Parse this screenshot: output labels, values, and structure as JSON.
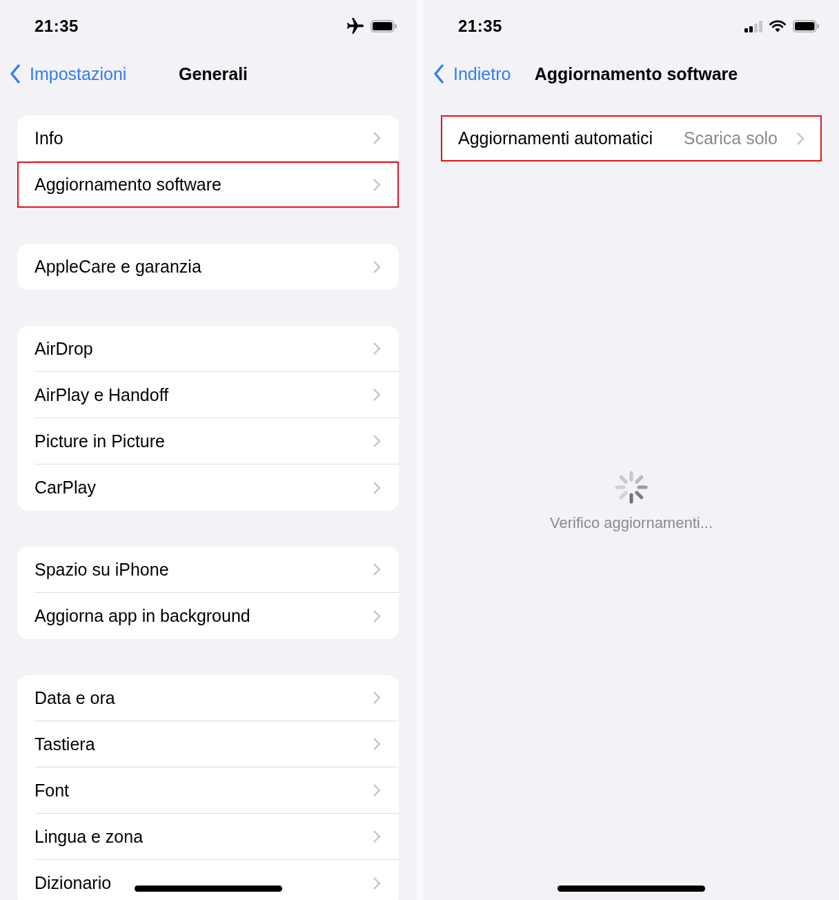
{
  "screens": [
    {
      "status_bar": {
        "time": "21:35",
        "airplane_mode": true
      },
      "nav": {
        "back": "Impostazioni",
        "title": "Generali"
      },
      "groups": [
        {
          "rows": [
            {
              "label": "Info",
              "highlighted": false
            },
            {
              "label": "Aggiornamento software",
              "highlighted": true
            }
          ]
        },
        {
          "rows": [
            {
              "label": "AppleCare e garanzia",
              "highlighted": false
            }
          ]
        },
        {
          "rows": [
            {
              "label": "AirDrop",
              "highlighted": false
            },
            {
              "label": "AirPlay e Handoff",
              "highlighted": false
            },
            {
              "label": "Picture in Picture",
              "highlighted": false
            },
            {
              "label": "CarPlay",
              "highlighted": false
            }
          ]
        },
        {
          "rows": [
            {
              "label": "Spazio su iPhone",
              "highlighted": false
            },
            {
              "label": "Aggiorna app in background",
              "highlighted": false
            }
          ]
        },
        {
          "rows": [
            {
              "label": "Data e ora",
              "highlighted": false
            },
            {
              "label": "Tastiera",
              "highlighted": false
            },
            {
              "label": "Font",
              "highlighted": false
            },
            {
              "label": "Lingua e zona",
              "highlighted": false
            },
            {
              "label": "Dizionario",
              "highlighted": false
            }
          ]
        }
      ]
    },
    {
      "status_bar": {
        "time": "21:35",
        "airplane_mode": false
      },
      "nav": {
        "back": "Indietro",
        "title": "Aggiornamento software"
      },
      "groups": [
        {
          "rows": [
            {
              "label": "Aggiornamenti automatici",
              "value": "Scarica solo",
              "highlighted": true
            }
          ]
        }
      ],
      "status": {
        "loading": true,
        "message": "Verifico aggiornamenti..."
      }
    }
  ]
}
